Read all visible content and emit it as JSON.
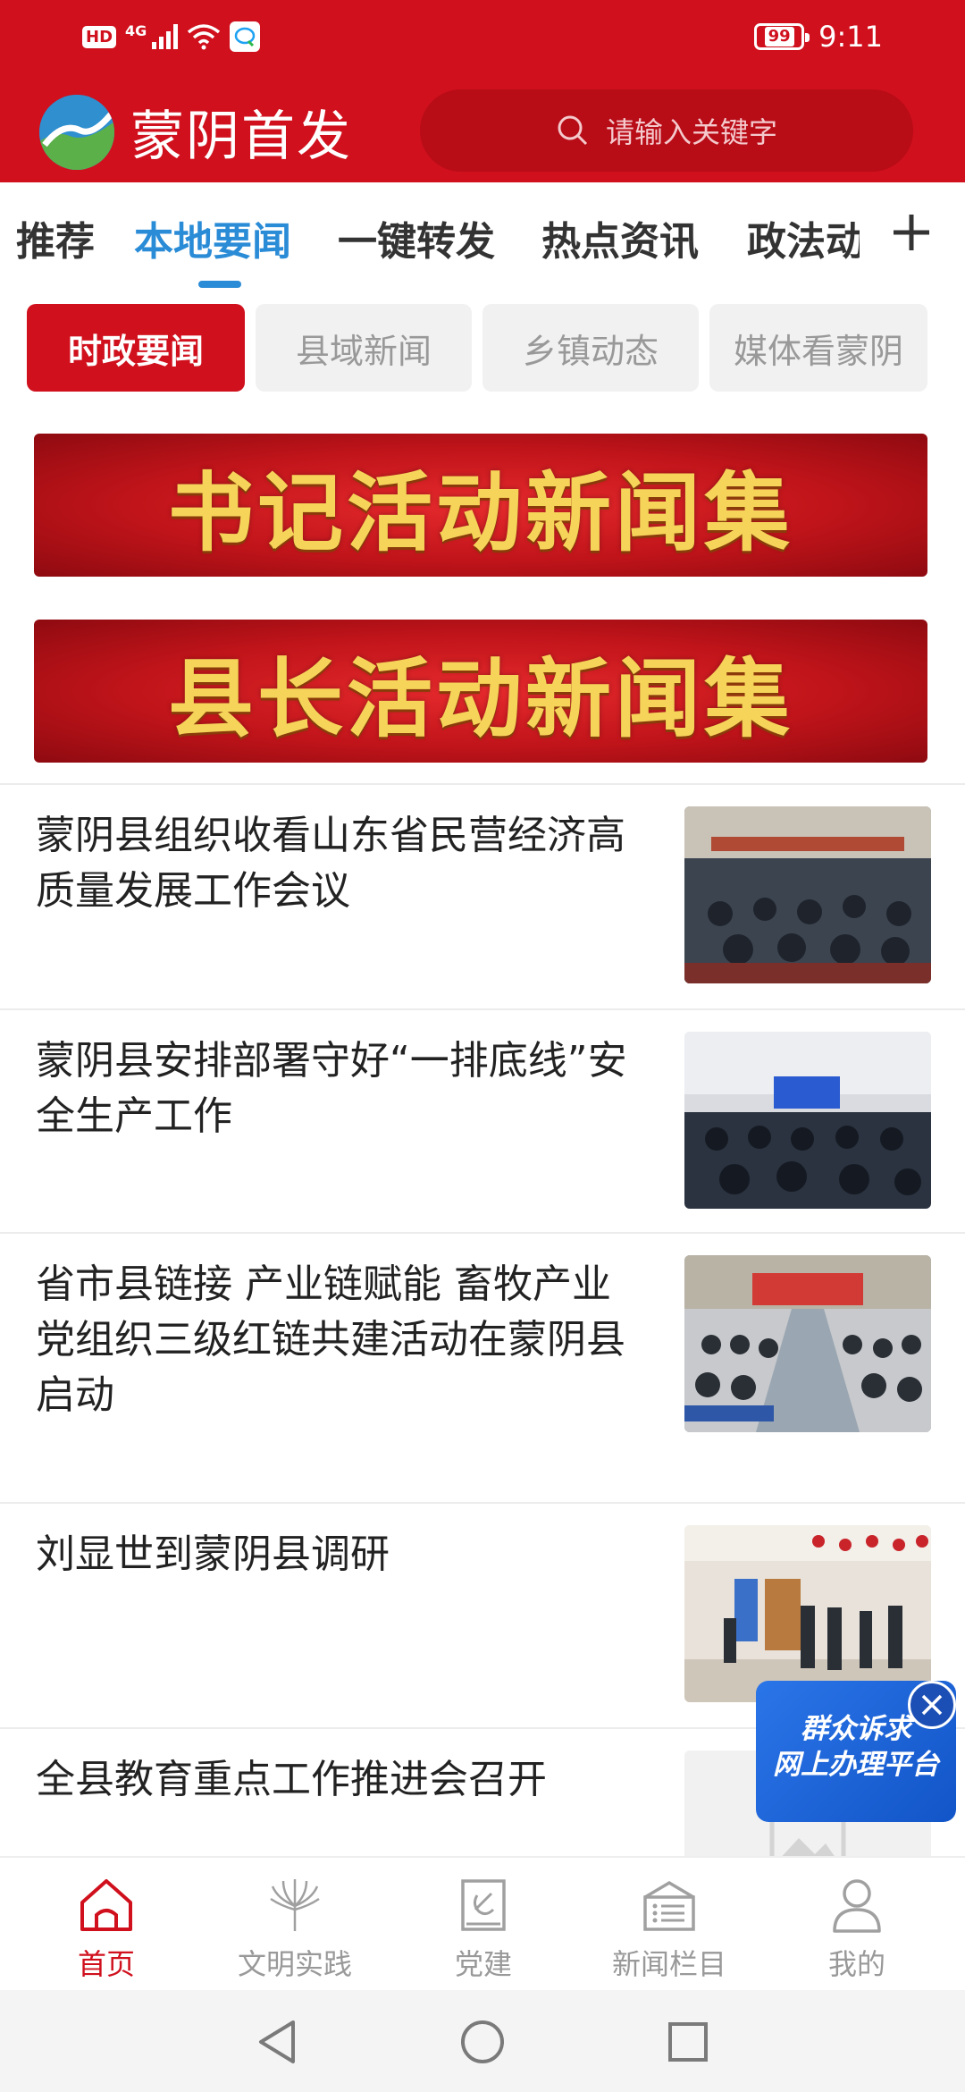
{
  "status_bar": {
    "hd": "HD",
    "network": "4G",
    "battery": "99",
    "time": "9:11"
  },
  "header": {
    "app_title": "蒙阴首发",
    "search_placeholder": "请输入关键字"
  },
  "tabs": [
    {
      "label": "推荐"
    },
    {
      "label": "本地要闻"
    },
    {
      "label": "一键转发"
    },
    {
      "label": "热点资讯"
    },
    {
      "label": "政法动"
    }
  ],
  "subtabs": [
    {
      "label": "时政要闻"
    },
    {
      "label": "县域新闻"
    },
    {
      "label": "乡镇动态"
    },
    {
      "label": "媒体看蒙阴"
    }
  ],
  "banners": [
    {
      "text": "书记活动新闻集"
    },
    {
      "text": "县长活动新闻集"
    }
  ],
  "news": [
    {
      "title": "蒙阴县组织收看山东省民营经济高质量发展工作会议"
    },
    {
      "title": "蒙阴县安排部署守好“一排底线”安全生产工作"
    },
    {
      "title": "省市县链接  产业链赋能  畜牧产业党组织三级红链共建活动在蒙阴县启动"
    },
    {
      "title": "刘显世到蒙阴县调研"
    },
    {
      "title": "全县教育重点工作推进会召开"
    }
  ],
  "float_card": {
    "line1": "群众诉求",
    "line2": "网上办理平台"
  },
  "bottom_nav": [
    {
      "label": "首页"
    },
    {
      "label": "文明实践"
    },
    {
      "label": "党建"
    },
    {
      "label": "新闻栏目"
    },
    {
      "label": "我的"
    }
  ],
  "colors": {
    "brand_red": "#d0101d",
    "tab_active_blue": "#2a8bd6",
    "banner_gold": "#f6d45a"
  }
}
